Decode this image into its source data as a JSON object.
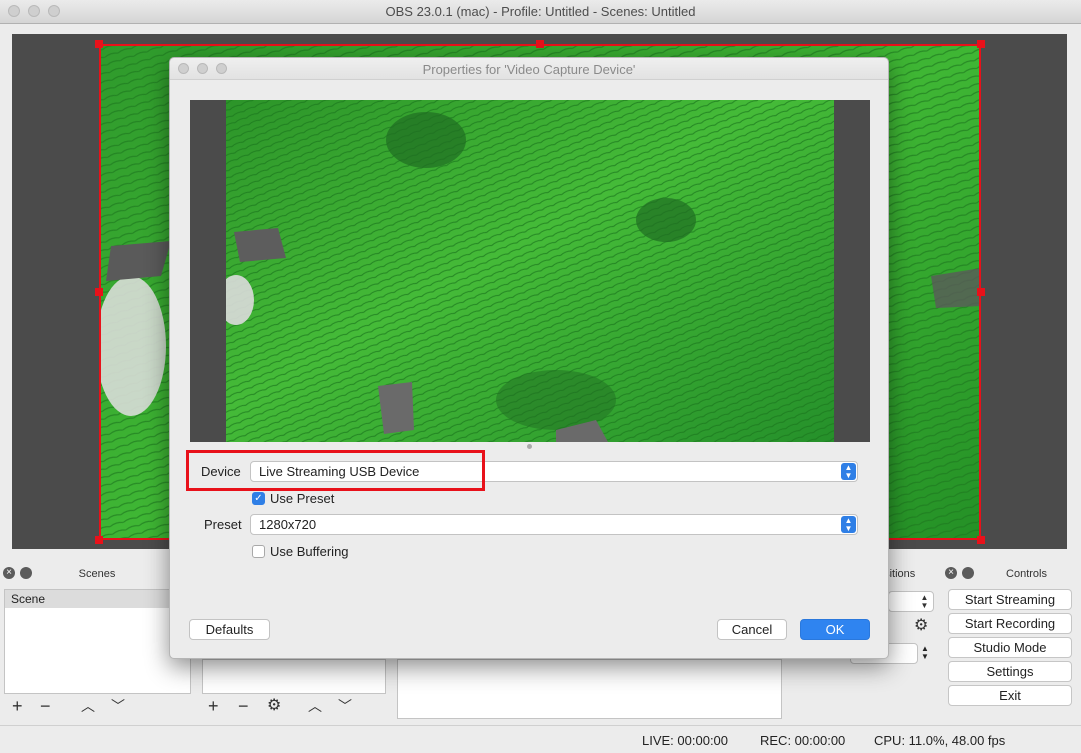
{
  "window": {
    "title": "OBS 23.0.1 (mac) - Profile: Untitled - Scenes: Untitled"
  },
  "docks": {
    "scenes": {
      "title": "Scenes",
      "items": [
        "Scene"
      ]
    },
    "transitions": {
      "title_partial": "nsitions",
      "duration_partial": "s"
    },
    "controls": {
      "title": "Controls",
      "buttons": [
        "Start Streaming",
        "Start Recording",
        "Studio Mode",
        "Settings",
        "Exit"
      ]
    }
  },
  "status": {
    "live": "LIVE: 00:00:00",
    "rec": "REC: 00:00:00",
    "cpu": "CPU: 11.0%, 48.00 fps"
  },
  "dialog": {
    "title": "Properties for 'Video Capture Device'",
    "device_label": "Device",
    "device_value": "Live Streaming USB Device",
    "use_preset_label": "Use Preset",
    "use_preset_checked": true,
    "preset_label": "Preset",
    "preset_value": "1280x720",
    "use_buffering_label": "Use Buffering",
    "use_buffering_checked": false,
    "defaults_label": "Defaults",
    "cancel_label": "Cancel",
    "ok_label": "OK"
  },
  "colors": {
    "accent": "#2f84f0",
    "selection_red": "#e8111a"
  }
}
